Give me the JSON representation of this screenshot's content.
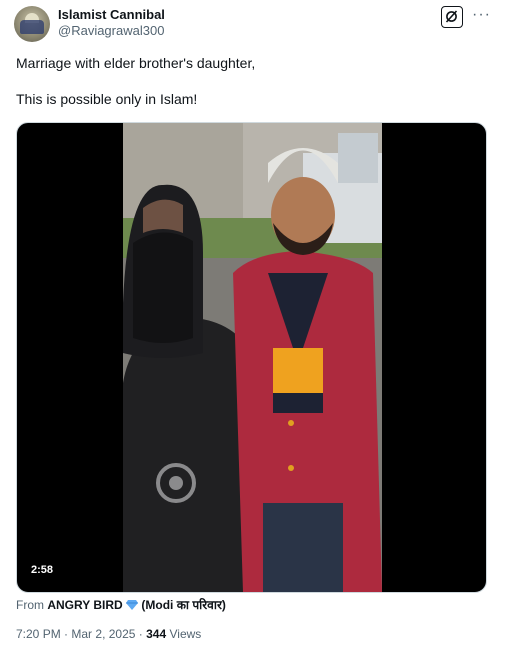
{
  "author": {
    "display_name": "Islamist Cannibal",
    "handle": "@Raviagrawal300"
  },
  "tweet": {
    "line1": "Marriage with elder brother's daughter,",
    "line2": "This is possible only in Islam!"
  },
  "media": {
    "duration": "2:58"
  },
  "attribution": {
    "prefix": "From",
    "source": "ANGRY BIRD",
    "badge_icon": "blue-diamond-icon",
    "source_suffix": "(Modi का परिवार)"
  },
  "meta": {
    "time": "7:20 PM",
    "separator": "·",
    "date": "Mar 2, 2025",
    "views_count": "344",
    "views_label": "Views"
  },
  "icons": {
    "grok": "grok-icon",
    "more": "more-horizontal-icon"
  },
  "colors": {
    "text_primary": "#0f1419",
    "text_secondary": "#536471",
    "media_bg": "#000000",
    "diamond": "#5ea9f2"
  }
}
